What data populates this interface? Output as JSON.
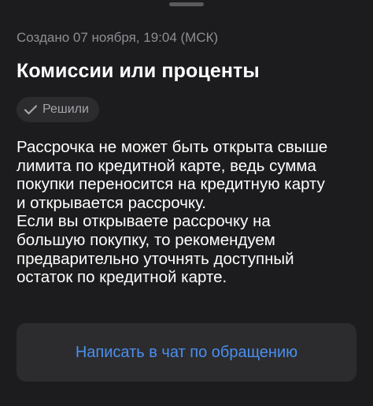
{
  "header": {
    "created": "Создано 07 ноября, 19:04 (МСК)",
    "title": "Комиссии или проценты"
  },
  "status": {
    "label": "Решили",
    "icon": "checkmark-icon"
  },
  "message": {
    "lines": [
      "Рассрочка не может быть открыта свыше",
      "лимита по кредитной карте, ведь сумма",
      "покупки переносится на кредитную карту",
      "и открывается рассрочку.",
      "Если вы открываете рассрочку на",
      "большую покупку, то рекомендуем",
      "предварительно уточнять доступный",
      "остаток по кредитной карте."
    ]
  },
  "actions": {
    "chat_button_label": "Написать в чат по обращению"
  },
  "colors": {
    "background": "#1c1c1e",
    "surface": "#2c2c2e",
    "accent": "#4a8ff0",
    "secondary_text": "#8e8e93"
  }
}
